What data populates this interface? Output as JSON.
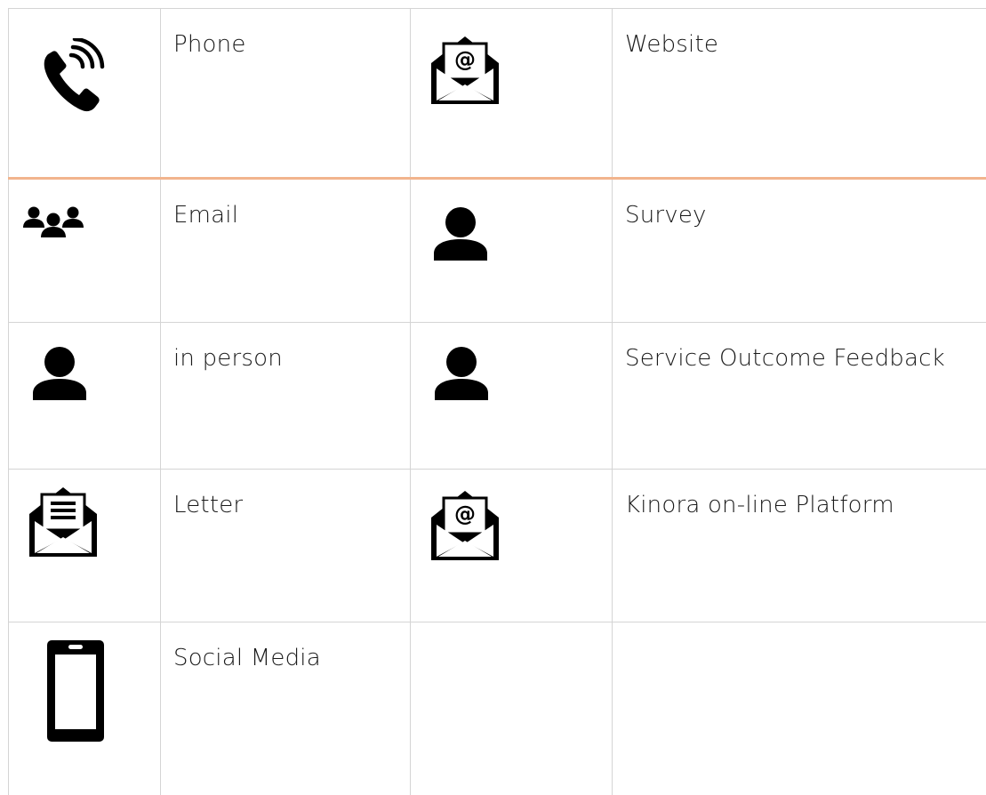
{
  "rows": [
    {
      "left": {
        "icon": "phone-ringing-icon",
        "label": "Phone"
      },
      "right": {
        "icon": "email-at-envelope-icon",
        "label": "Website"
      }
    },
    {
      "left": {
        "icon": "group-icon",
        "label": "Email"
      },
      "right": {
        "icon": "person-icon",
        "label": "Survey"
      }
    },
    {
      "left": {
        "icon": "person-icon",
        "label": "in person"
      },
      "right": {
        "icon": "person-icon",
        "label": "Service Outcome Feedback"
      }
    },
    {
      "left": {
        "icon": "letter-envelope-icon",
        "label": "Letter"
      },
      "right": {
        "icon": "email-at-envelope-icon",
        "label": "Kinora on-line Platform"
      }
    },
    {
      "left": {
        "icon": "mobile-phone-icon",
        "label": "Social Media"
      },
      "right": {
        "icon": "",
        "label": ""
      }
    }
  ],
  "colors": {
    "header_rule": "#f2b48d",
    "grid": "#d4d4d4",
    "icon": "#000000"
  }
}
